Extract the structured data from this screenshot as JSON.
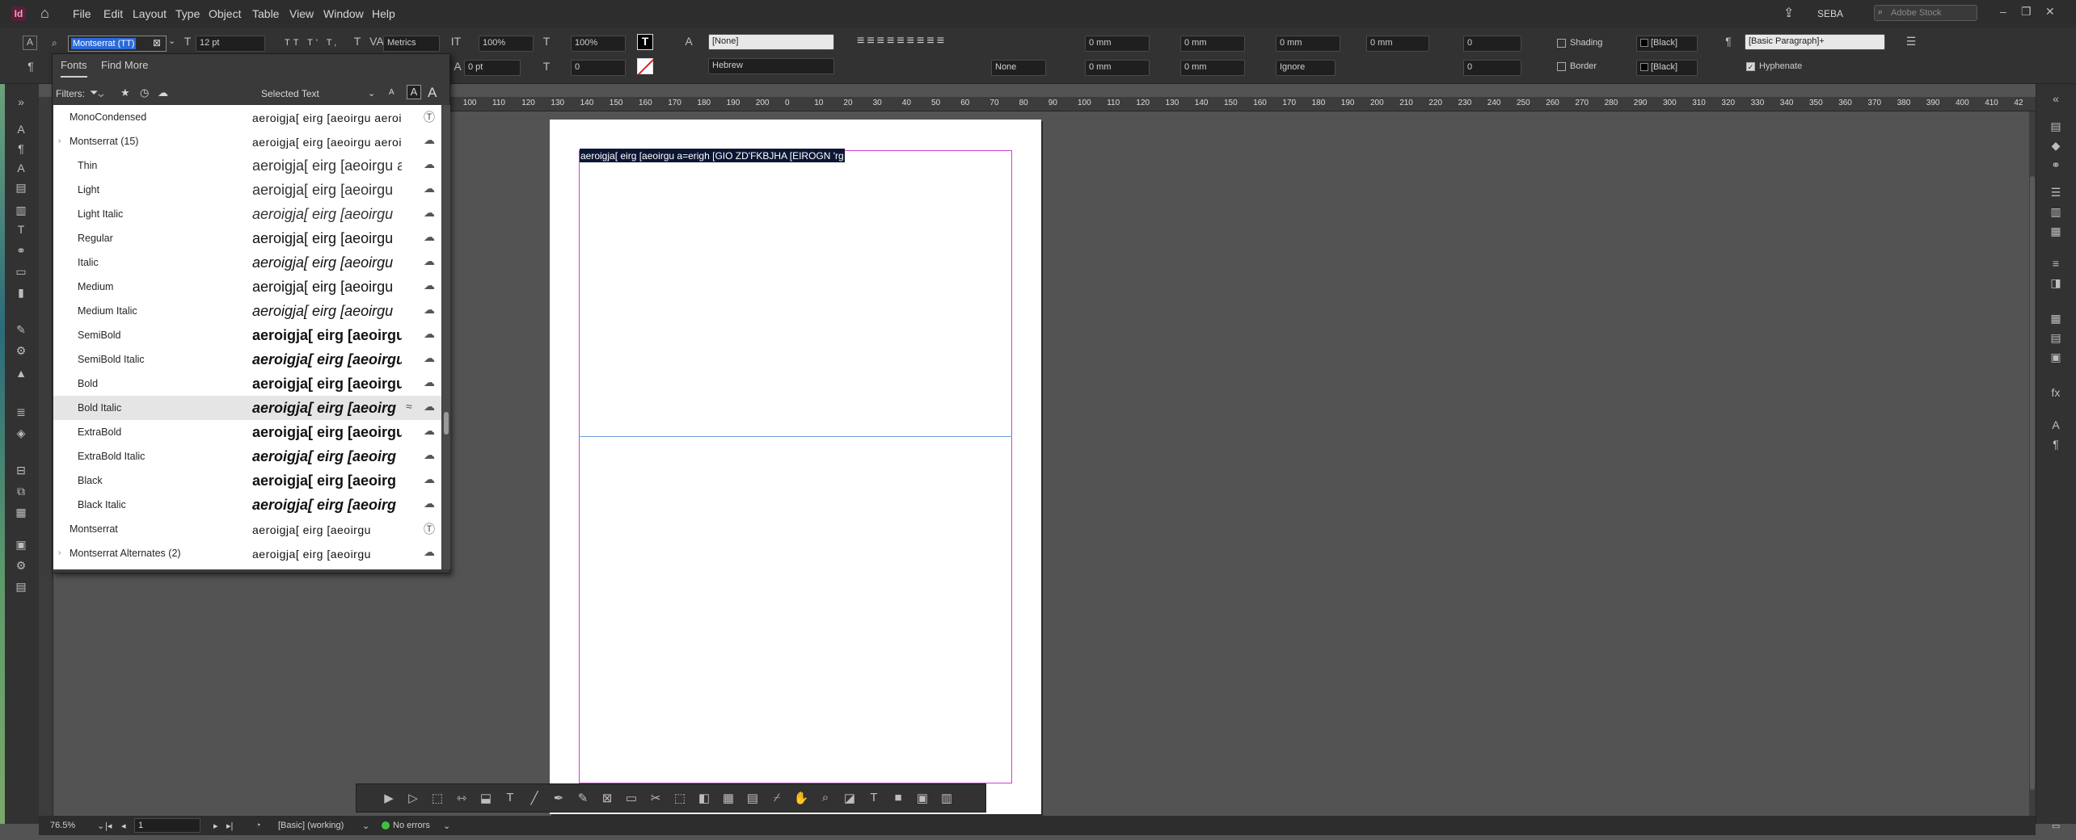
{
  "menubar": {
    "items": [
      "File",
      "Edit",
      "Layout",
      "Type",
      "Object",
      "Table",
      "View",
      "Window",
      "Help"
    ],
    "user": "SEBA",
    "stock_search_placeholder": "Adobe Stock"
  },
  "control": {
    "font_family": "Montserrat (TT)",
    "tab_fonts": "Fonts",
    "tab_find_more": "Find More",
    "font_size": "12 pt",
    "leading": "0 pt",
    "kerning": "Metrics",
    "vertical_scale": "100%",
    "horizontal_scale": "100%",
    "tracking": "0",
    "baseline": "0",
    "language_none": "[None]",
    "language": "Hebrew",
    "kashida": "None",
    "indent_left": "0 mm",
    "indent_right": "0 mm",
    "first_indent": "0 mm",
    "last_indent": "0 mm",
    "space_before": "0 mm",
    "space_after": "0 mm",
    "drop_cap_lines": "0",
    "drop_cap_chars": "0",
    "align_grid": "Ignore",
    "shading_label": "Shading",
    "border_label": "Border",
    "swatch_black": "[Black]",
    "paragraph_style": "[Basic Paragraph]+",
    "hyphenate_label": "Hyphenate"
  },
  "font_panel": {
    "filters_label": "Filters:",
    "selected_text": "Selected Text",
    "sample_a_small": "A",
    "sample_a_mid": "A",
    "sample_a_large": "A",
    "rows": [
      {
        "name": "MonoCondensed",
        "preview": "aeroigja[ eirg [aeoirgu aeroigja[ eirg",
        "icon": "Tt"
      },
      {
        "name": "Montserrat (15)",
        "preview": "aeroigja[ eirg [aeoirgu aeroigja[",
        "icon": "cloud"
      },
      {
        "name": "Thin",
        "preview": "aeroigja[ eirg [aeoirgu aeroigja[",
        "icon": "cloud"
      },
      {
        "name": "Light",
        "preview": "aeroigja[ eirg [aeoirgu",
        "icon": "cloud"
      },
      {
        "name": "Light Italic",
        "preview": "aeroigja[ eirg [aeoirgu",
        "icon": "cloud"
      },
      {
        "name": "Regular",
        "preview": "aeroigja[ eirg [aeoirgu",
        "icon": "cloud"
      },
      {
        "name": "Italic",
        "preview": "aeroigja[ eirg [aeoirgu",
        "icon": "cloud"
      },
      {
        "name": "Medium",
        "preview": "aeroigja[ eirg [aeoirgu",
        "icon": "cloud"
      },
      {
        "name": "Medium Italic",
        "preview": "aeroigja[ eirg [aeoirgu",
        "icon": "cloud"
      },
      {
        "name": "SemiBold",
        "preview": "aeroigja[ eirg [aeoirgu",
        "icon": "cloud"
      },
      {
        "name": "SemiBold Italic",
        "preview": "aeroigja[ eirg [aeoirgu",
        "icon": "cloud"
      },
      {
        "name": "Bold",
        "preview": "aeroigja[ eirg [aeoirgu",
        "icon": "cloud"
      },
      {
        "name": "Bold Italic",
        "preview": "aeroigja[ eirg [aeoirg",
        "icon": "cloud",
        "approx": "≈"
      },
      {
        "name": "ExtraBold",
        "preview": "aeroigja[ eirg [aeoirgu",
        "icon": "cloud"
      },
      {
        "name": "ExtraBold Italic",
        "preview": "aeroigja[ eirg [aeoirg",
        "icon": "cloud"
      },
      {
        "name": "Black",
        "preview": "aeroigja[ eirg [aeoirg",
        "icon": "cloud"
      },
      {
        "name": "Black Italic",
        "preview": "aeroigja[ eirg [aeoirg",
        "icon": "cloud"
      },
      {
        "name": "Montserrat",
        "preview": "aeroigja[ eirg [aeoirgu",
        "icon": "Tt"
      },
      {
        "name": "Montserrat Alternates (2)",
        "preview": "aeroigja[ eirg [aeoirgu",
        "icon": "cloud"
      }
    ]
  },
  "ruler_h": [
    "40",
    "30",
    "20",
    "10",
    "0",
    "10",
    "20",
    "30",
    "40",
    "50",
    "60",
    "70",
    "80",
    "90",
    "100",
    "110",
    "120",
    "130",
    "140",
    "150",
    "160",
    "170",
    "180",
    "190",
    "200",
    "0",
    "10",
    "20",
    "30",
    "40",
    "50",
    "60",
    "70",
    "80",
    "90",
    "100",
    "110",
    "120",
    "130",
    "140",
    "150",
    "160",
    "170",
    "180",
    "190",
    "200",
    "210",
    "220",
    "230",
    "240",
    "250",
    "260",
    "270",
    "280",
    "290",
    "300",
    "310",
    "320",
    "330",
    "340",
    "350",
    "360",
    "370",
    "380",
    "390",
    "400",
    "410",
    "42"
  ],
  "document": {
    "selected_text": "aeroigja[ eirg [aeoirgu a=erigh [GIO ZD'FKBJHA [EIROGN 'rg"
  },
  "status": {
    "zoom": "76.5%",
    "page": "1",
    "mode": "[Basic] (working)",
    "errors": "No errors"
  }
}
